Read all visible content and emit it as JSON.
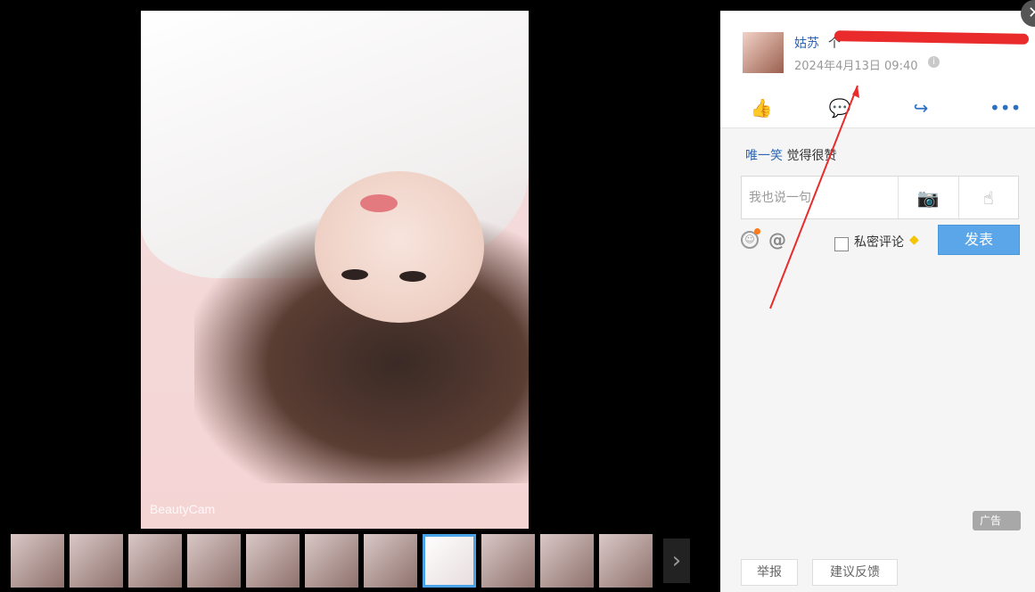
{
  "photo": {
    "watermark": "BeautyCam"
  },
  "thumbnails": {
    "count": 11,
    "active_index": 7
  },
  "post": {
    "author": "姑苏",
    "author_tail": "个",
    "time": "2024年4月13日 09:40"
  },
  "actions": {
    "like_icon": "thumbs-up-icon",
    "comment_icon": "comment-icon",
    "share_icon": "share-icon",
    "more_icon": "more-icon"
  },
  "likes": {
    "name": "唯一笑",
    "text": "觉得很赞"
  },
  "comment": {
    "placeholder": "我也说一句"
  },
  "private": {
    "label": "私密评论"
  },
  "buttons": {
    "post": "发表",
    "report": "举报",
    "feedback": "建议反馈",
    "ad": "广告"
  },
  "colors": {
    "accent": "#5aa6e9",
    "link": "#2d64b3",
    "annotation": "#ea2b2b"
  }
}
